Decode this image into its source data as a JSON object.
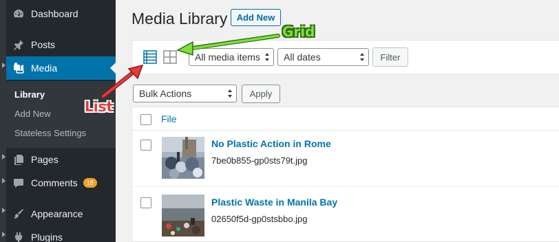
{
  "sidebar": {
    "items": [
      {
        "label": "Dashboard",
        "icon": "dashboard-icon"
      },
      {
        "label": "Posts",
        "icon": "pin-icon"
      },
      {
        "label": "Media",
        "icon": "media-icon",
        "current": true
      },
      {
        "label": "Pages",
        "icon": "pages-icon"
      },
      {
        "label": "Comments",
        "icon": "comments-icon",
        "badge": "18"
      },
      {
        "label": "Appearance",
        "icon": "brush-icon"
      },
      {
        "label": "Plugins",
        "icon": "plugin-icon"
      }
    ],
    "submenu": [
      {
        "label": "Library",
        "active": true
      },
      {
        "label": "Add New"
      },
      {
        "label": "Stateless Settings"
      }
    ]
  },
  "header": {
    "title": "Media Library",
    "add_new_label": "Add New"
  },
  "toolbar": {
    "list_view_icon": "list-view-icon",
    "grid_view_icon": "grid-view-icon",
    "media_filter": "All media items",
    "date_filter": "All dates",
    "filter_button": "Filter"
  },
  "bulk": {
    "action": "Bulk Actions",
    "apply_button": "Apply"
  },
  "table": {
    "column_file": "File",
    "rows": [
      {
        "title": "No Plastic Action in Rome",
        "filename": "7be0b855-gp0sts79t.jpg"
      },
      {
        "title": "Plastic Waste in Manila Bay",
        "filename": "02650f5d-gp0stsbbo.jpg"
      }
    ]
  },
  "annotations": {
    "grid_label": "Grid",
    "list_label": "List"
  },
  "colors": {
    "sidebar_bg": "#23282d",
    "accent": "#0073aa",
    "grid_annotation": "#7ee13a",
    "list_annotation": "#e53b3b",
    "badge": "#f0a028"
  }
}
